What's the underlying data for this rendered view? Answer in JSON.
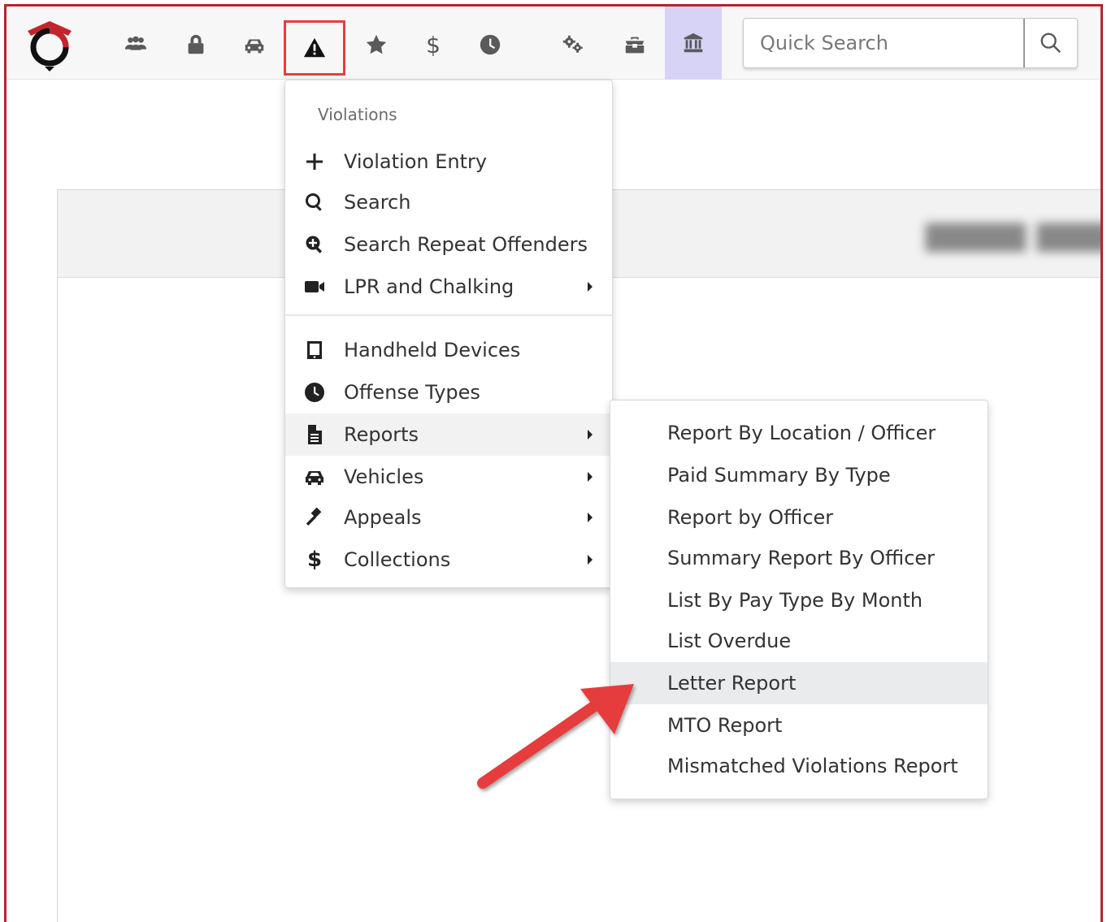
{
  "navbar": {
    "icons": [
      "logo-icon",
      "users-icon",
      "lock-icon",
      "car-icon",
      "warning-icon",
      "star-icon",
      "dollar-icon",
      "clock-icon",
      "gears-icon",
      "toolbox-icon",
      "building-icon",
      "search-icon"
    ],
    "dollar_symbol": "$",
    "search_placeholder": "Quick Search",
    "active_highlight_color": "#d6d3f7",
    "selected_outline_color": "#e53e3e"
  },
  "menu": {
    "header": "Violations",
    "items": [
      {
        "label": "Violation Entry",
        "icon": "plus-icon"
      },
      {
        "label": "Search",
        "icon": "search-icon"
      },
      {
        "label": "Search Repeat Offenders",
        "icon": "search-plus-icon"
      },
      {
        "label": "LPR and Chalking",
        "icon": "video-camera-icon",
        "submenu": true
      },
      {
        "label": "Handheld Devices",
        "icon": "tablet-icon"
      },
      {
        "label": "Offense Types",
        "icon": "clock-icon"
      },
      {
        "label": "Reports",
        "icon": "file-icon",
        "submenu": true
      },
      {
        "label": "Vehicles",
        "icon": "car-icon",
        "submenu": true
      },
      {
        "label": "Appeals",
        "icon": "gavel-icon",
        "submenu": true
      },
      {
        "label": "Collections",
        "icon": "dollar-icon",
        "submenu": true
      }
    ]
  },
  "submenu": {
    "items": [
      "Report By Location / Officer",
      "Paid Summary By Type",
      "Report by Officer",
      "Summary Report By Officer",
      "List By Pay Type By Month",
      "List Overdue",
      "Letter Report",
      "MTO Report",
      "Mismatched Violations Report"
    ],
    "selected": "Letter Report"
  },
  "colors": {
    "frame_border": "#b3262d",
    "arrow": "#e53e3e"
  }
}
